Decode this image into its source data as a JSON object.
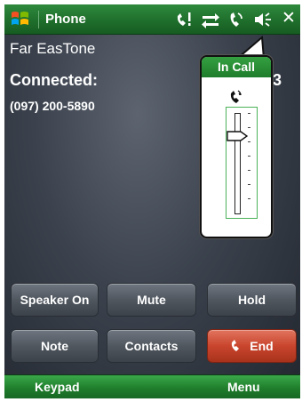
{
  "titlebar": {
    "title": "Phone",
    "close_label": "✕"
  },
  "call": {
    "carrier": "Far EasTone",
    "status": "Connected:",
    "duration": "33",
    "number": "(097) 200-5890"
  },
  "volume_popup": {
    "header": "In Call",
    "volume_level_fraction": 0.8
  },
  "buttons": {
    "speaker": "Speaker On",
    "mute": "Mute",
    "hold": "Hold",
    "note": "Note",
    "contacts": "Contacts",
    "end": "End"
  },
  "softkeys": {
    "left": "Keypad",
    "right": "Menu"
  },
  "colors": {
    "accent_green": "#1f7d2b",
    "end_red": "#c9452d"
  }
}
